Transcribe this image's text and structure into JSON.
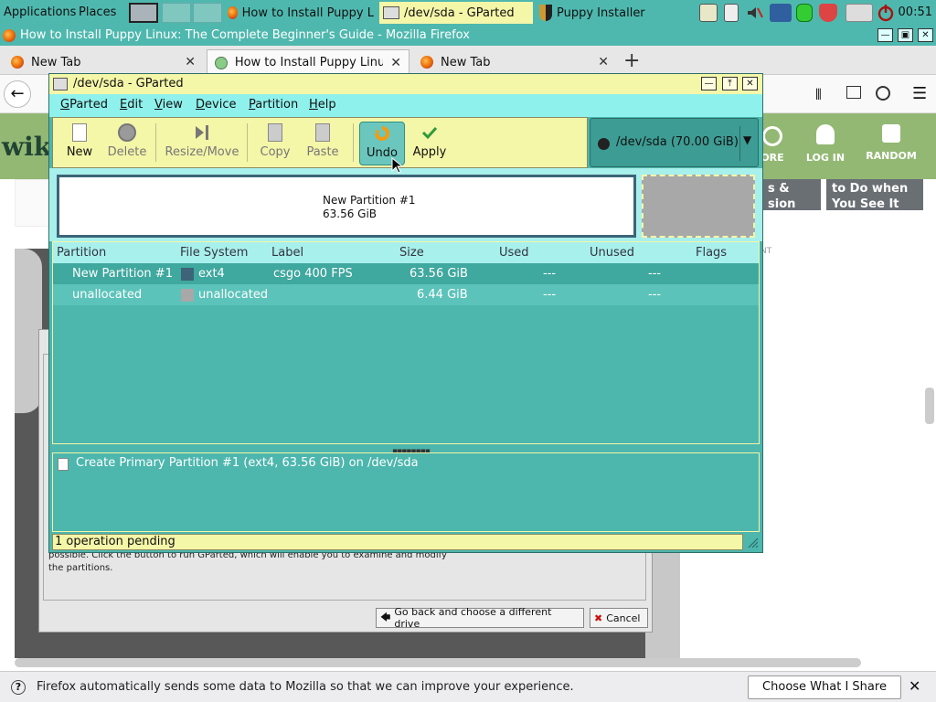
{
  "taskbar": {
    "applications": "Applications",
    "places": "Places",
    "tasks": [
      {
        "label": "How to Install Puppy L"
      },
      {
        "label": "/dev/sda - GParted"
      },
      {
        "label": "Puppy Installer"
      }
    ],
    "clock": "00:51"
  },
  "firefox": {
    "window_title": "How to Install Puppy Linux: The Complete Beginner's Guide - Mozilla Firefox",
    "tabs": [
      {
        "label": "New Tab"
      },
      {
        "label": "How to Install Puppy Linu"
      },
      {
        "label": "New Tab"
      }
    ],
    "new_tab_symbol": "+",
    "notification": "Firefox automatically sends some data to Mozilla so that we can improve your experience.",
    "notification_button": "Choose What I Share"
  },
  "webpage": {
    "logo": "wiki",
    "nav": [
      "LOG IN",
      "RANDOM"
    ],
    "nav_partial": "ORE",
    "card1": [
      "s &",
      "sion"
    ],
    "card2": [
      "to Do when",
      "You See It"
    ],
    "ad_label": "NT"
  },
  "installer": {
    "message_lines": [
      "possible. Click the button to run GParted, which will enable you to examine and modify",
      "the partitions."
    ],
    "back_button": "Go back and choose a different drive",
    "cancel_button": "Cancel"
  },
  "gparted": {
    "title": "/dev/sda - GParted",
    "menu": [
      {
        "first": "G",
        "rest": "Parted"
      },
      {
        "first": "E",
        "rest": "dit"
      },
      {
        "first": "V",
        "rest": "iew"
      },
      {
        "first": "D",
        "rest": "evice"
      },
      {
        "first": "P",
        "rest": "artition"
      },
      {
        "first": "H",
        "rest": "elp"
      }
    ],
    "toolbar": {
      "new": "New",
      "delete": "Delete",
      "resize": "Resize/Move",
      "copy": "Copy",
      "paste": "Paste",
      "undo": "Undo",
      "apply": "Apply"
    },
    "device": "/dev/sda  (70.00 GiB)",
    "visual": {
      "partition_name": "New Partition #1",
      "partition_size": "63.56 GiB",
      "partition_fraction": 0.908
    },
    "columns": [
      "Partition",
      "File System",
      "Label",
      "Size",
      "Used",
      "Unused",
      "Flags"
    ],
    "rows": [
      {
        "partition": "New Partition #1",
        "fs": "ext4",
        "fs_color": "#3d6478",
        "label": "csgo 400 FPS",
        "size": "63.56 GiB",
        "used": "---",
        "unused": "---",
        "flags": ""
      },
      {
        "partition": "unallocated",
        "fs": "unallocated",
        "fs_color": "#a8a8a8",
        "label": "",
        "size": "6.44 GiB",
        "used": "---",
        "unused": "---",
        "flags": ""
      }
    ],
    "operation": "Create Primary Partition #1 (ext4, 63.56 GiB) on /dev/sda",
    "status": "1 operation pending"
  }
}
